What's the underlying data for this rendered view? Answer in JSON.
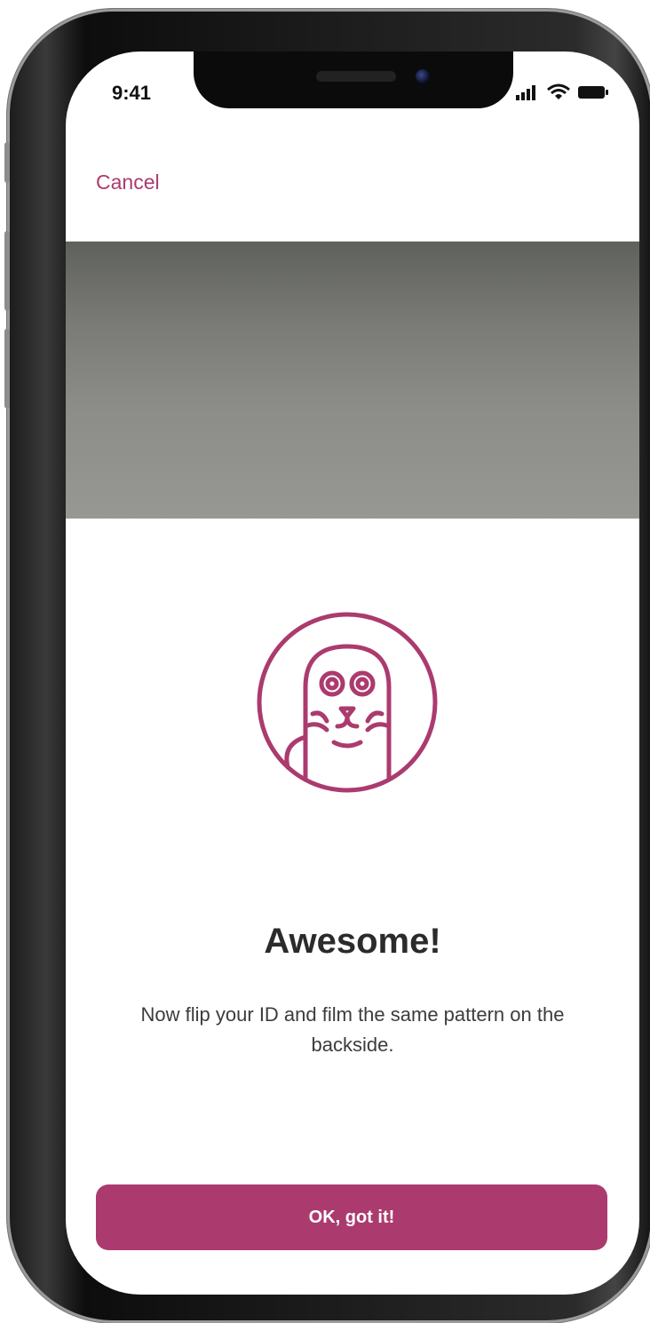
{
  "colors": {
    "accent": "#ab3b6e",
    "title_text": "#2b2b2b",
    "body_text": "#3c3c3c",
    "camera_view": "#7a7b77"
  },
  "status_bar": {
    "time": "9:41",
    "icons": [
      "signal-icon",
      "wifi-icon",
      "battery-icon"
    ]
  },
  "nav": {
    "cancel_label": "Cancel"
  },
  "content": {
    "logo_icon": "seal-icon",
    "title": "Awesome!",
    "message": "Now flip your ID and film the same pattern on the backside."
  },
  "footer": {
    "ok_label": "OK, got it!"
  }
}
